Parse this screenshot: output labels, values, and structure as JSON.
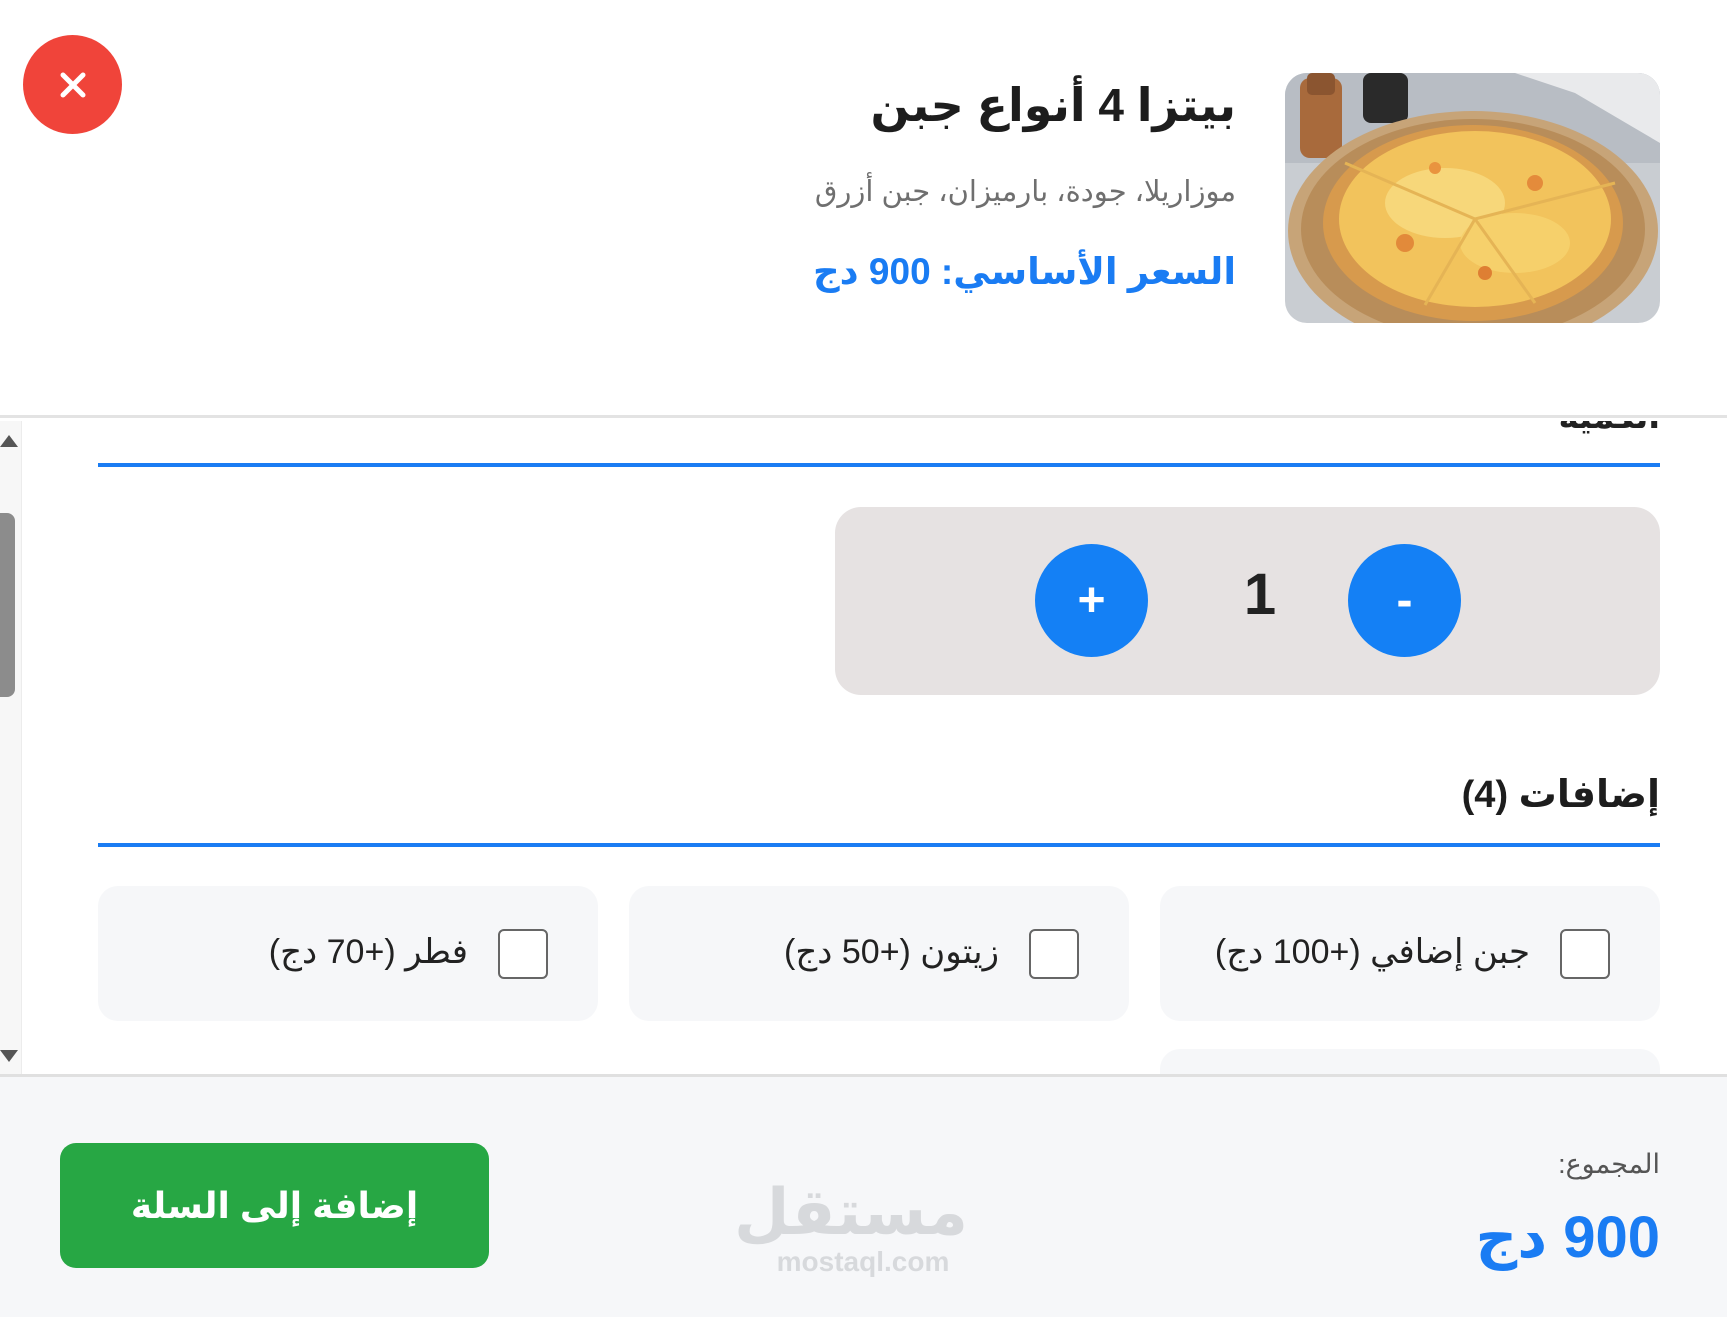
{
  "product": {
    "title": "بيتزا 4 أنواع جبن",
    "description": "موزاريلا، جودة، بارميزان، جبن أزرق",
    "base_price": "السعر الأساسي: 900 دج",
    "image_icon": "pizza-image"
  },
  "close": {
    "icon": "close-icon",
    "color": "#f0443a"
  },
  "section": {
    "cut_title": "الكمية"
  },
  "quantity": {
    "value": "1",
    "plus_label": "+",
    "minus_label": "-"
  },
  "addons": {
    "title": "إضافات (4)",
    "items": [
      {
        "label": "جبن إضافي (+100 دج)",
        "checked": false
      },
      {
        "label": "زيتون (+50 دج)",
        "checked": false
      },
      {
        "label": "فطر (+70 دج)",
        "checked": false
      },
      {
        "label": "",
        "checked": false
      }
    ]
  },
  "footer": {
    "total_label": "المجموع:",
    "total_value": "900 دج",
    "add_to_cart_label": "إضافة إلى السلة"
  },
  "watermark": {
    "arabic": "مستقل",
    "latin": "mostaql.com"
  },
  "colors": {
    "accent": "#1a7cf3",
    "button_blue": "#1480f5",
    "cart_green": "#27a744",
    "qty_bg": "#e6e2e2"
  }
}
